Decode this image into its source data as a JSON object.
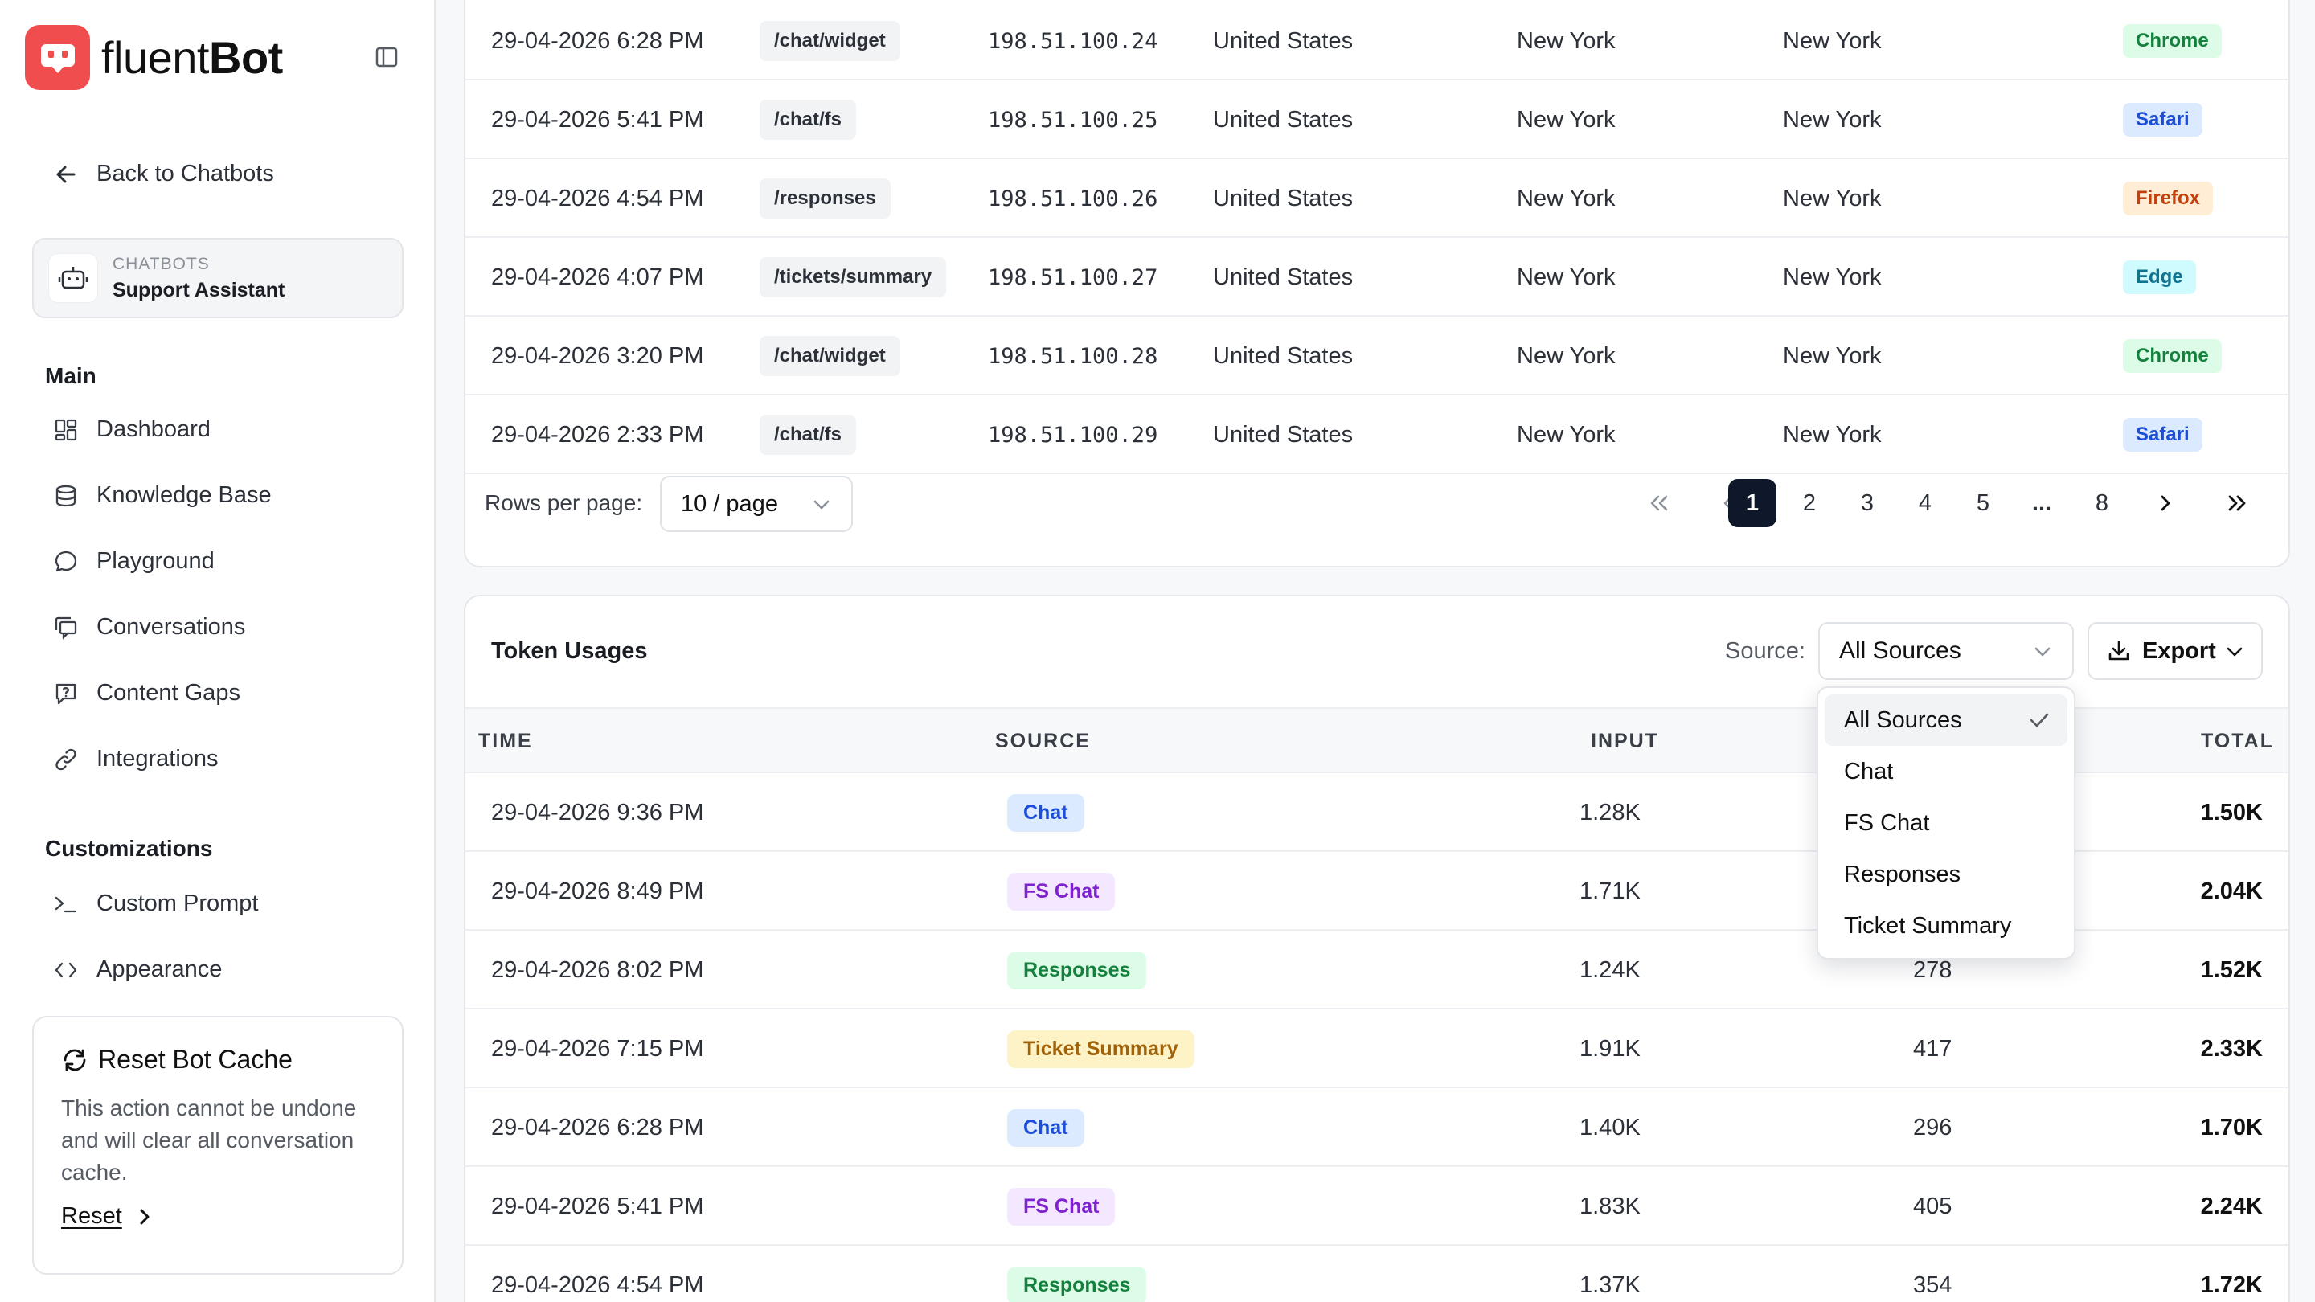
{
  "brand": {
    "name_light": "fluent",
    "name_bold": "Bot",
    "color": "#f04e4e"
  },
  "sidebar": {
    "back_label": "Back to Chatbots",
    "bot_label": "CHATBOTS",
    "bot_name": "Support Assistant",
    "sections": {
      "main": "Main",
      "customizations": "Customizations"
    },
    "main_items": [
      {
        "label": "Dashboard",
        "icon": "dashboard-icon"
      },
      {
        "label": "Knowledge Base",
        "icon": "database-icon"
      },
      {
        "label": "Playground",
        "icon": "chat-bubble-icon"
      },
      {
        "label": "Conversations",
        "icon": "conversations-icon"
      },
      {
        "label": "Content Gaps",
        "icon": "question-icon"
      },
      {
        "label": "Integrations",
        "icon": "link-icon"
      }
    ],
    "custom_items": [
      {
        "label": "Custom Prompt",
        "icon": "terminal-icon"
      },
      {
        "label": "Appearance",
        "icon": "code-icon"
      }
    ],
    "reset": {
      "title": "Reset Bot Cache",
      "description": "This action cannot be undone and will clear all conversation cache.",
      "link": "Reset"
    }
  },
  "visits": {
    "rows": [
      {
        "time": "29-04-2026 6:28 PM",
        "path": "/chat/widget",
        "ip": "198.51.100.24",
        "country": "United States",
        "region": "New York",
        "city": "New York",
        "browser": "Chrome"
      },
      {
        "time": "29-04-2026 5:41 PM",
        "path": "/chat/fs",
        "ip": "198.51.100.25",
        "country": "United States",
        "region": "New York",
        "city": "New York",
        "browser": "Safari"
      },
      {
        "time": "29-04-2026 4:54 PM",
        "path": "/responses",
        "ip": "198.51.100.26",
        "country": "United States",
        "region": "New York",
        "city": "New York",
        "browser": "Firefox"
      },
      {
        "time": "29-04-2026 4:07 PM",
        "path": "/tickets/summary",
        "ip": "198.51.100.27",
        "country": "United States",
        "region": "New York",
        "city": "New York",
        "browser": "Edge"
      },
      {
        "time": "29-04-2026 3:20 PM",
        "path": "/chat/widget",
        "ip": "198.51.100.28",
        "country": "United States",
        "region": "New York",
        "city": "New York",
        "browser": "Chrome"
      },
      {
        "time": "29-04-2026 2:33 PM",
        "path": "/chat/fs",
        "ip": "198.51.100.29",
        "country": "United States",
        "region": "New York",
        "city": "New York",
        "browser": "Safari"
      }
    ],
    "browser_colors": {
      "Chrome": {
        "bg": "#dcfce7",
        "fg": "#15803d"
      },
      "Safari": {
        "bg": "#dbeafe",
        "fg": "#1d4ed8"
      },
      "Firefox": {
        "bg": "#ffedd5",
        "fg": "#c2410c"
      },
      "Edge": {
        "bg": "#cffafe",
        "fg": "#0e7490"
      }
    },
    "pagination": {
      "rows_per_page_label": "Rows per page:",
      "rows_per_page_value": "10 / page",
      "pages": [
        "1",
        "2",
        "3",
        "4",
        "5",
        "...",
        "8"
      ],
      "current_page": "1"
    }
  },
  "tokens": {
    "title": "Token Usages",
    "source_label": "Source:",
    "source_value": "All Sources",
    "export_label": "Export",
    "columns": {
      "time": "TIME",
      "source": "SOURCE",
      "input": "INPUT",
      "total": "TOTAL"
    },
    "rows": [
      {
        "time": "29-04-2026 9:36 PM",
        "source": "Chat",
        "input": "1.28K",
        "output": "",
        "total": "1.50K"
      },
      {
        "time": "29-04-2026 8:49 PM",
        "source": "FS Chat",
        "input": "1.71K",
        "output": "",
        "total": "2.04K"
      },
      {
        "time": "29-04-2026 8:02 PM",
        "source": "Responses",
        "input": "1.24K",
        "output": "278",
        "total": "1.52K"
      },
      {
        "time": "29-04-2026 7:15 PM",
        "source": "Ticket Summary",
        "input": "1.91K",
        "output": "417",
        "total": "2.33K"
      },
      {
        "time": "29-04-2026 6:28 PM",
        "source": "Chat",
        "input": "1.40K",
        "output": "296",
        "total": "1.70K"
      },
      {
        "time": "29-04-2026 5:41 PM",
        "source": "FS Chat",
        "input": "1.83K",
        "output": "405",
        "total": "2.24K"
      },
      {
        "time": "29-04-2026 4:54 PM",
        "source": "Responses",
        "input": "1.37K",
        "output": "354",
        "total": "1.72K"
      }
    ],
    "source_colors": {
      "Chat": {
        "bg": "#dbeafe",
        "fg": "#1d4ed8"
      },
      "FS Chat": {
        "bg": "#f3e8ff",
        "fg": "#7e22ce"
      },
      "Responses": {
        "bg": "#dcfce7",
        "fg": "#15803d"
      },
      "Ticket Summary": {
        "bg": "#fef3c7",
        "fg": "#a16207"
      }
    },
    "dropdown_options": [
      "All Sources",
      "Chat",
      "FS Chat",
      "Responses",
      "Ticket Summary"
    ]
  }
}
